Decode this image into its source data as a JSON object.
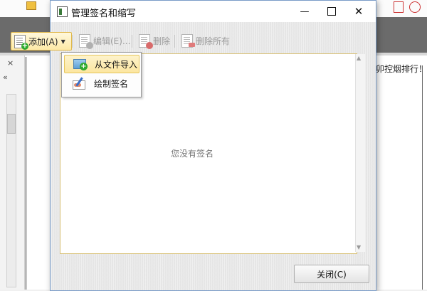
{
  "dialog": {
    "title": "管理签名和缩写",
    "minimize_symbol": "—",
    "close_symbol": "✕"
  },
  "toolbar": {
    "add_label": "添加(A)",
    "edit_label": "编辑(E)...",
    "delete_label": "删除",
    "delete_all_label": "删除所有"
  },
  "add_menu": {
    "items": [
      {
        "label": "从文件导入",
        "icon": "image-import-icon"
      },
      {
        "label": "绘制签名",
        "icon": "draw-signature-icon"
      }
    ]
  },
  "list": {
    "empty_text": "您没有签名"
  },
  "footer": {
    "close_label": "关闭(C)"
  },
  "background_app": {
    "doc_text": "卯控烟排行！",
    "panel_close": "×",
    "panel_chevron": "«"
  },
  "colors": {
    "accent_border": "#e0b84a",
    "dialog_border": "#7a9cc8",
    "ribbon": "#6b6b6b"
  }
}
